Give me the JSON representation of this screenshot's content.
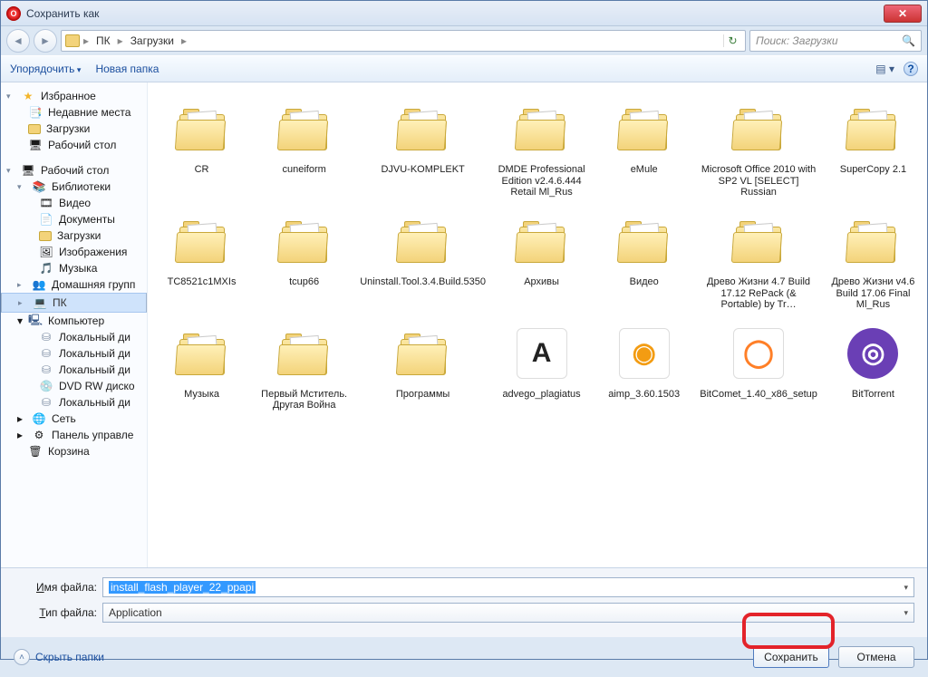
{
  "window": {
    "title": "Сохранить как"
  },
  "breadcrumb": {
    "seg1": "ПК",
    "seg2": "Загрузки",
    "refresh_glyph": "↻"
  },
  "search": {
    "placeholder": "Поиск: Загрузки"
  },
  "cmdbar": {
    "organize": "Упорядочить",
    "new_folder": "Новая папка",
    "help_glyph": "?"
  },
  "sidebar": {
    "fav_head": "Избранное",
    "fav": [
      {
        "label": "Недавние места",
        "ico": "📑"
      },
      {
        "label": "Загрузки",
        "ico": "folder"
      },
      {
        "label": "Рабочий стол",
        "ico": "🖥"
      }
    ],
    "desk_head": "Рабочий стол",
    "lib_head": "Библиотеки",
    "libs": [
      {
        "label": "Видео",
        "ico": "🎞"
      },
      {
        "label": "Документы",
        "ico": "📄"
      },
      {
        "label": "Загрузки",
        "ico": "folder"
      },
      {
        "label": "Изображения",
        "ico": "🖼"
      },
      {
        "label": "Музыка",
        "ico": "🎵"
      }
    ],
    "homegroup": "Домашняя групп",
    "pk": "ПК",
    "computer": "Компьютер",
    "drives": [
      "Локальный ди",
      "Локальный ди",
      "Локальный ди",
      "DVD RW диско",
      "Локальный ди"
    ],
    "network": "Сеть",
    "cpanel": "Панель управле",
    "recycle": "Корзина"
  },
  "files": [
    {
      "label": "CR",
      "kind": "folder"
    },
    {
      "label": "cuneiform",
      "kind": "folder"
    },
    {
      "label": "DJVU-KOMPLEKT",
      "kind": "folder"
    },
    {
      "label": "DMDE Professional Edition v2.4.6.444 Retail Ml_Rus",
      "kind": "folder"
    },
    {
      "label": "eMule",
      "kind": "folder"
    },
    {
      "label": "Microsoft Office 2010 with SP2 VL [SELECT] Russian",
      "kind": "folder"
    },
    {
      "label": "SuperCopy 2.1",
      "kind": "folder"
    },
    {
      "label": "TC8521c1MXIs",
      "kind": "folder"
    },
    {
      "label": "tcup66",
      "kind": "folder"
    },
    {
      "label": "Uninstall.Tool.3.4.Build.5350",
      "kind": "folder"
    },
    {
      "label": "Архивы",
      "kind": "folder"
    },
    {
      "label": "Видео",
      "kind": "folder"
    },
    {
      "label": "Древо Жизни 4.7 Build 17.12 RePack (& Portable) by Tr…",
      "kind": "folder"
    },
    {
      "label": "Древо Жизни v4.6 Build 17.06 Final Ml_Rus",
      "kind": "folder"
    },
    {
      "label": "Музыка",
      "kind": "folder"
    },
    {
      "label": "Первый Мститель. Другая Война",
      "kind": "folder"
    },
    {
      "label": "Программы",
      "kind": "folder"
    },
    {
      "label": "advego_plagiatus",
      "kind": "exe",
      "glyph": "A",
      "bg": "#ffffff",
      "fg": "#222"
    },
    {
      "label": "aimp_3.60.1503",
      "kind": "exe",
      "glyph": "◉",
      "bg": "#ffffff",
      "fg": "#f39c12"
    },
    {
      "label": "BitComet_1.40_x86_setup",
      "kind": "exe",
      "glyph": "◯",
      "bg": "#ffffff",
      "fg": "#ff7f27"
    },
    {
      "label": "BitTorrent",
      "kind": "exe",
      "glyph": "◎",
      "bg": "#6a3fb5",
      "fg": "#ffffff"
    }
  ],
  "filename": {
    "label": "Имя файла:",
    "value": "install_flash_player_22_ppapi"
  },
  "filetype": {
    "label": "Тип файла:",
    "value": "Application"
  },
  "footer": {
    "hide": "Скрыть папки",
    "save": "Сохранить",
    "cancel": "Отмена"
  }
}
